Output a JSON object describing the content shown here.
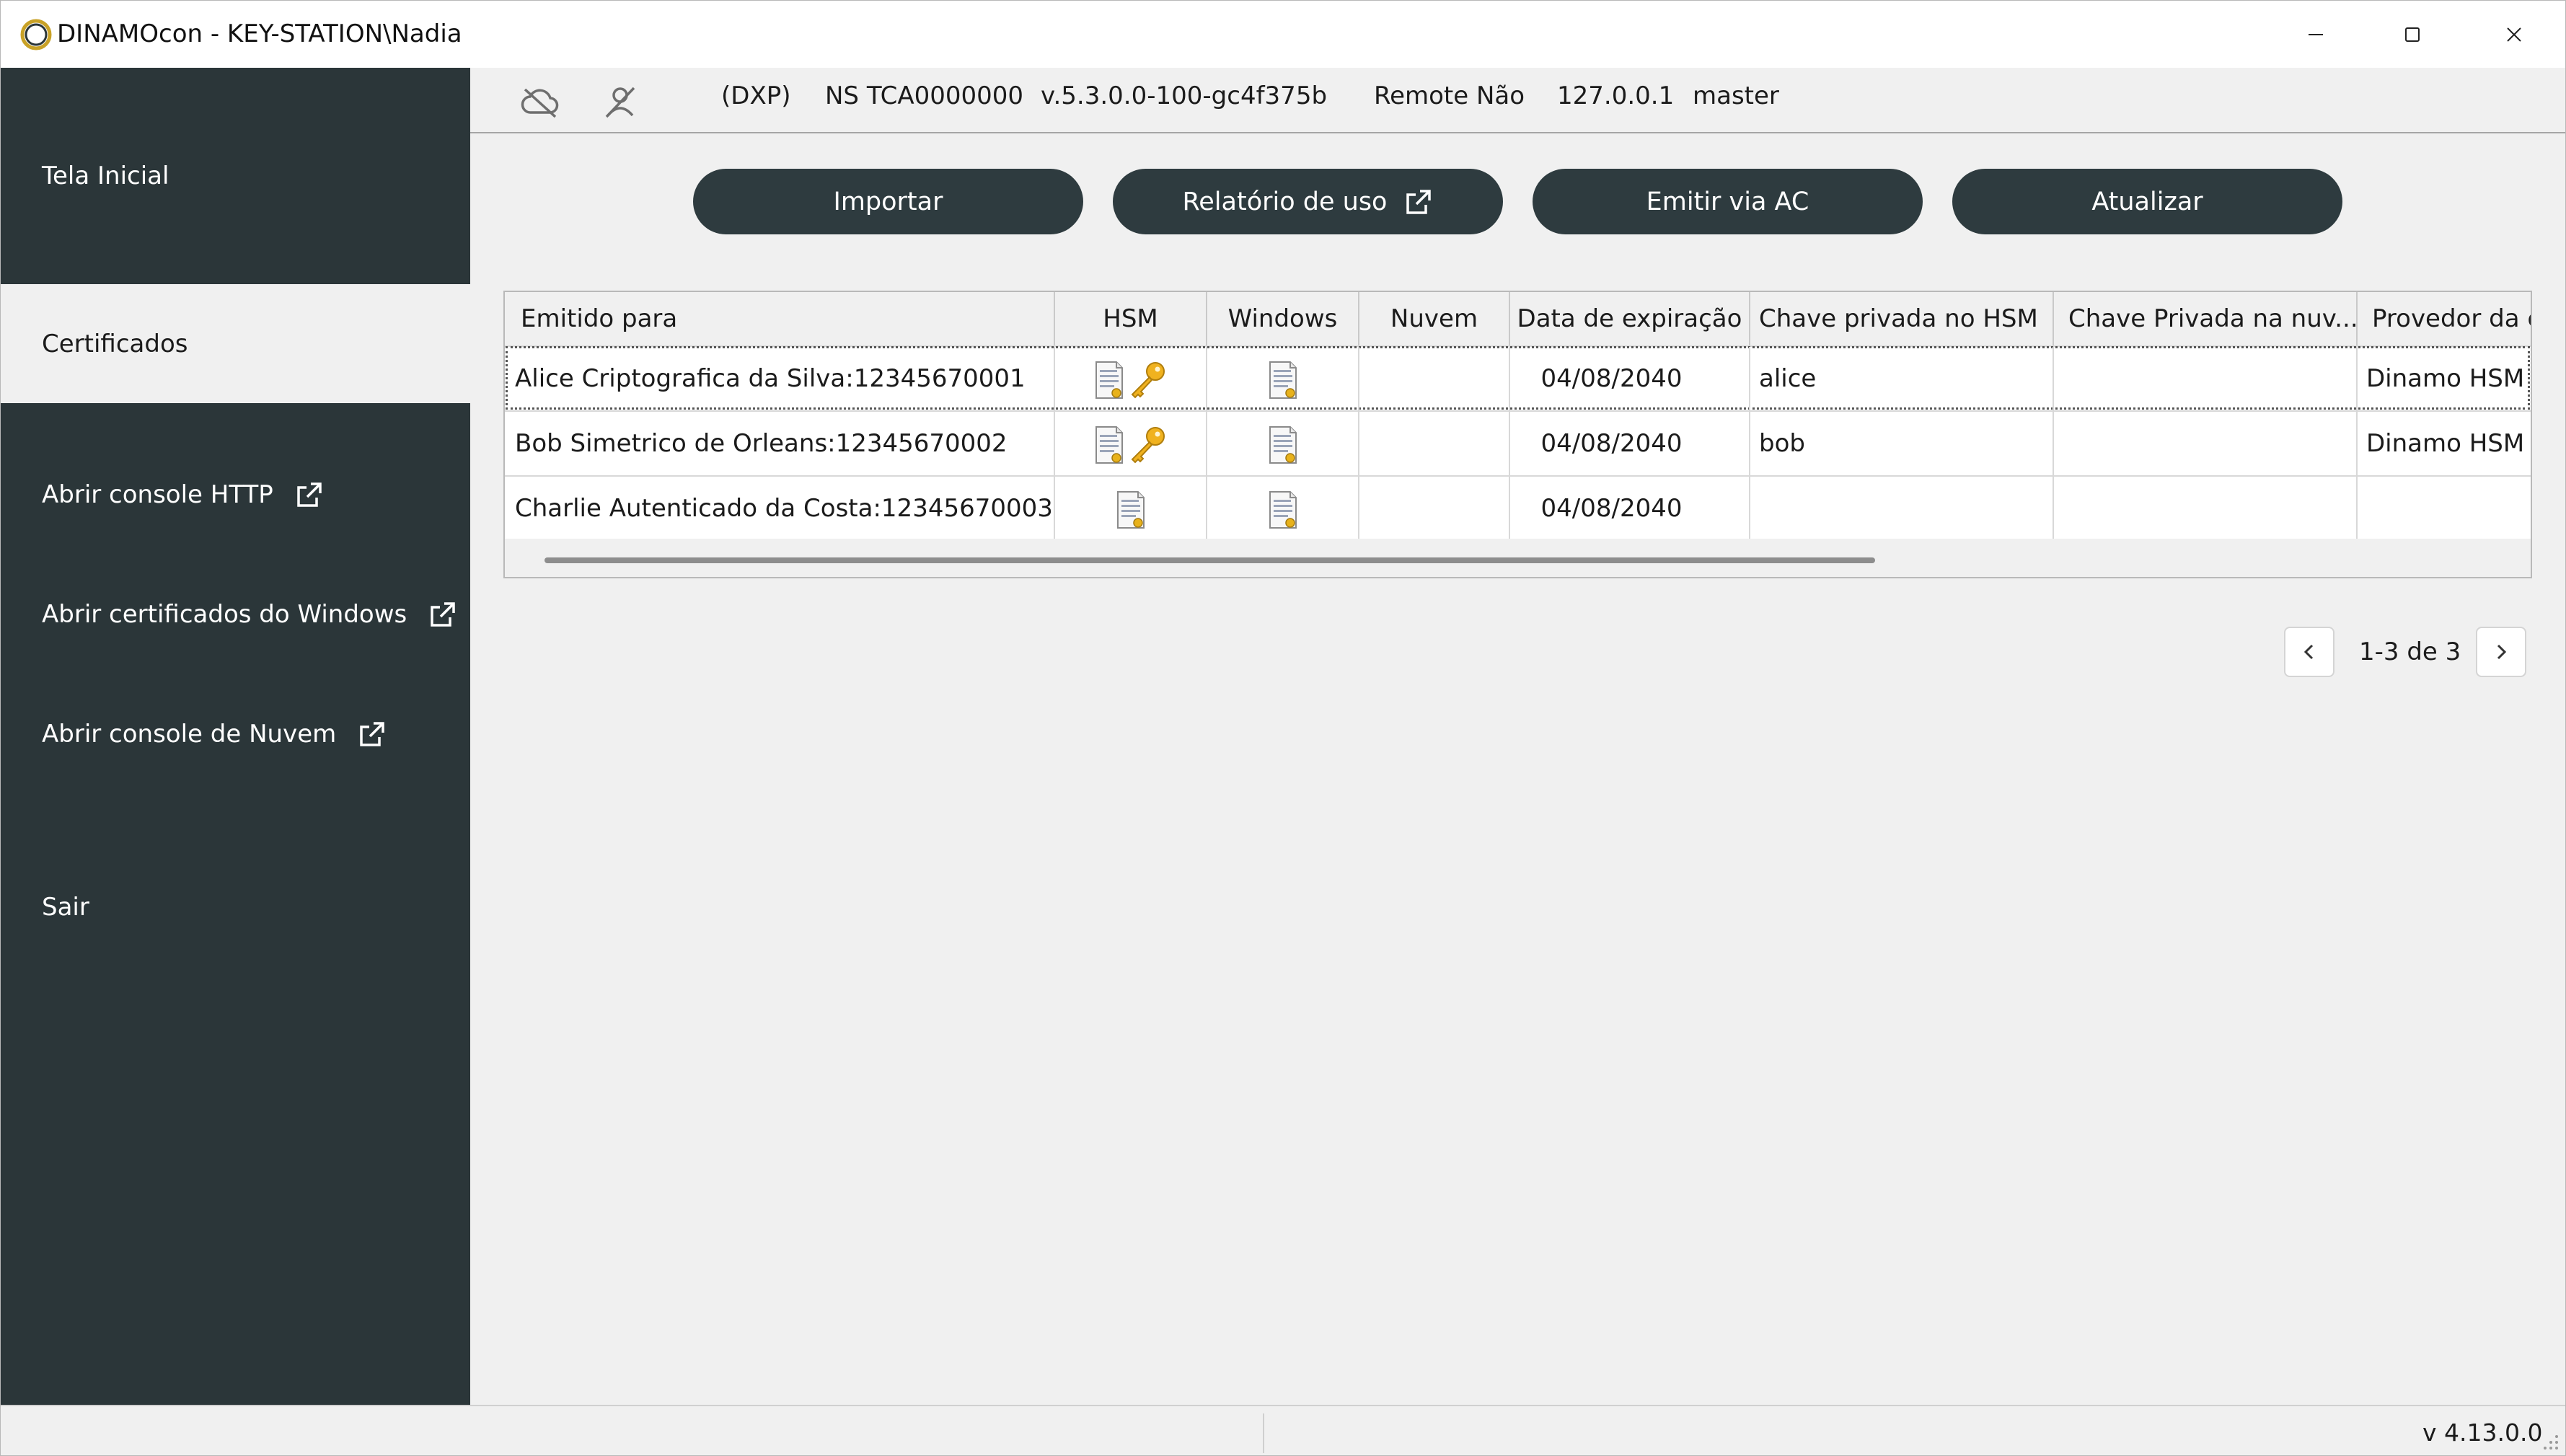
{
  "window": {
    "title": "DINAMOcon - KEY-STATION\\Nadia",
    "controls": [
      "minimize",
      "maximize",
      "close"
    ]
  },
  "sidebar": {
    "items": [
      {
        "label": "Tela Inicial",
        "active": false,
        "external": false
      },
      {
        "label": "Certificados",
        "active": true,
        "external": false
      },
      {
        "label": "Abrir console HTTP",
        "active": false,
        "external": true
      },
      {
        "label": "Abrir certificados do Windows",
        "active": false,
        "external": true
      },
      {
        "label": "Abrir console de Nuvem",
        "active": false,
        "external": true
      },
      {
        "label": "Sair",
        "active": false,
        "external": false
      }
    ]
  },
  "infobar": {
    "icons": [
      "cloud-off-icon",
      "user-off-icon"
    ],
    "mode": "(DXP)",
    "serial": "NS TCA0000000",
    "firmware": "v.5.3.0.0-100-gc4f375b",
    "remote": "Remote Não",
    "ip": "127.0.0.1",
    "user": "master"
  },
  "actions": {
    "import": "Importar",
    "usage_report": "Relatório de uso",
    "issue_ca": "Emitir via AC",
    "refresh": "Atualizar"
  },
  "table": {
    "headers": [
      "Emitido para",
      "HSM",
      "Windows",
      "Nuvem",
      "Data de expiração",
      "Chave privada no HSM",
      "Chave Privada na nuv...",
      "Provedor da cl"
    ],
    "rows": [
      {
        "issued_to": "Alice Criptografica da Silva:12345670001",
        "hsm": [
          "certificate-icon",
          "key-icon"
        ],
        "windows": [
          "certificate-icon"
        ],
        "cloud": "",
        "expiry": "04/08/2040",
        "hsm_key": "alice",
        "cloud_key": "",
        "provider": "Dinamo HSM C"
      },
      {
        "issued_to": "Bob Simetrico de Orleans:12345670002",
        "hsm": [
          "certificate-icon",
          "key-icon"
        ],
        "windows": [
          "certificate-icon"
        ],
        "cloud": "",
        "expiry": "04/08/2040",
        "hsm_key": "bob",
        "cloud_key": "",
        "provider": "Dinamo HSM C"
      },
      {
        "issued_to": "Charlie Autenticado da Costa:12345670003",
        "hsm": [
          "certificate-icon"
        ],
        "windows": [
          "certificate-icon"
        ],
        "cloud": "",
        "expiry": "04/08/2040",
        "hsm_key": "",
        "cloud_key": "",
        "provider": ""
      }
    ]
  },
  "pager": {
    "label": "1-3 de 3"
  },
  "status": {
    "version": "v 4.13.0.0"
  },
  "colors": {
    "sidebar": "#2b3639",
    "button": "#2e3b3f",
    "background": "#f0f0f0",
    "key": "#e0a411"
  }
}
